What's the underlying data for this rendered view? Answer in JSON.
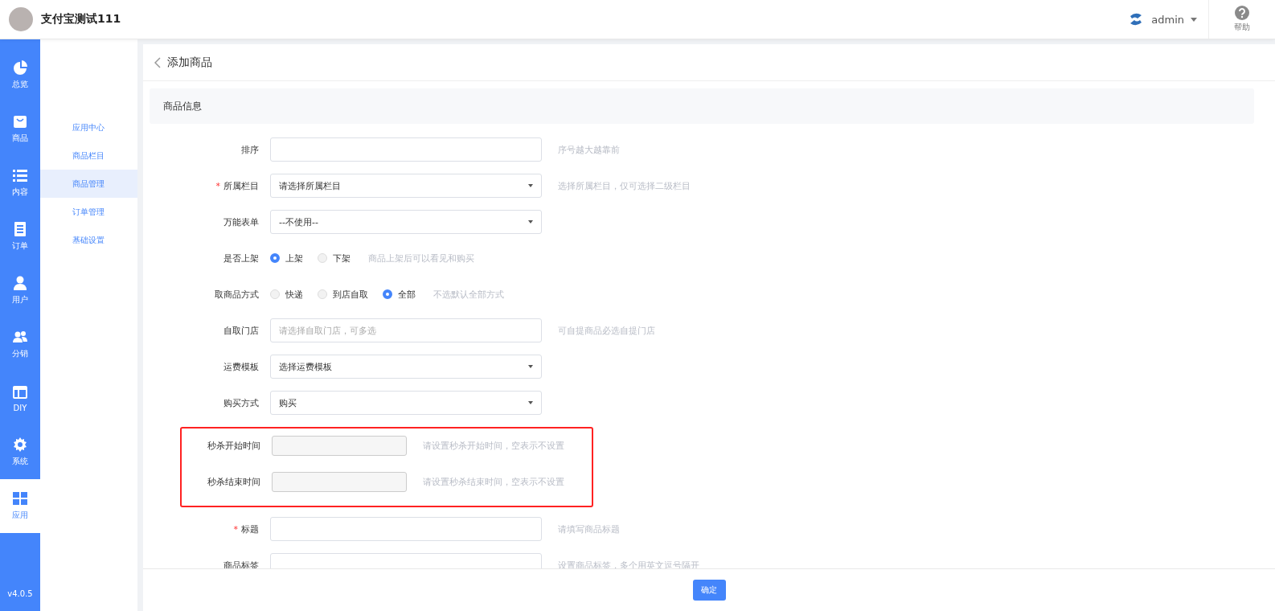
{
  "header": {
    "shop_name": "支付宝测试111",
    "user": "admin",
    "help": "帮助"
  },
  "main_nav": {
    "items": [
      {
        "label": "总览",
        "selected": false
      },
      {
        "label": "商品",
        "selected": false
      },
      {
        "label": "内容",
        "selected": false
      },
      {
        "label": "订单",
        "selected": false
      },
      {
        "label": "用户",
        "selected": false
      },
      {
        "label": "分销",
        "selected": false
      },
      {
        "label": "DIY",
        "selected": false
      },
      {
        "label": "系统",
        "selected": false
      },
      {
        "label": "应用",
        "selected": true
      }
    ],
    "version": "v4.0.5"
  },
  "sub_nav": {
    "items": [
      {
        "label": "应用中心",
        "selected": false
      },
      {
        "label": "商品栏目",
        "selected": false
      },
      {
        "label": "商品管理",
        "selected": true
      },
      {
        "label": "订单管理",
        "selected": false
      },
      {
        "label": "基础设置",
        "selected": false
      }
    ]
  },
  "page": {
    "title": "添加商品",
    "section": "商品信息",
    "rows": [
      {
        "kind": "input",
        "label": "排序",
        "highlighted": false,
        "hint": "序号越大越靠前"
      },
      {
        "kind": "select",
        "label": "所属栏目",
        "marker": "*",
        "highlighted": false,
        "value": "请选择所属栏目",
        "hint": "选择所属栏目，仅可选择二级栏目"
      },
      {
        "kind": "select",
        "label": "万能表单",
        "highlighted": false,
        "value": "--不使用--"
      },
      {
        "kind": "radio",
        "label": "是否上架",
        "highlighted": false,
        "options": [
          {
            "label": "上架",
            "selected": true
          },
          {
            "label": "下架",
            "selected": false
          }
        ],
        "hint": "商品上架后可以看见和购买"
      },
      {
        "kind": "radio",
        "label": "取商品方式",
        "highlighted": false,
        "options": [
          {
            "label": "快递",
            "selected": false
          },
          {
            "label": "到店自取",
            "selected": false
          },
          {
            "label": "全部",
            "selected": true
          }
        ],
        "hint": "不选默认全部方式"
      },
      {
        "kind": "input",
        "label": "自取门店",
        "highlighted": false,
        "placeholder": "请选择自取门店，可多选",
        "hint": "可自提商品必选自提门店"
      },
      {
        "kind": "select",
        "label": "运费模板",
        "highlighted": false,
        "value": "选择运费模板"
      },
      {
        "kind": "select",
        "label": "购买方式",
        "highlighted": false,
        "value": "购买"
      },
      {
        "kind": "time",
        "label": "秒杀开始时间",
        "highlighted": true,
        "hint": "请设置秒杀开始时间，空表示不设置"
      },
      {
        "kind": "time",
        "label": "秒杀结束时间",
        "highlighted": true,
        "hint": "请设置秒杀结束时间，空表示不设置"
      },
      {
        "kind": "input",
        "label": "标题",
        "marker": "*",
        "highlighted": false,
        "hint": "请填写商品标题"
      },
      {
        "kind": "input",
        "label": "商品标签",
        "highlighted": false,
        "hint": "设置商品标签，多个用英文逗号隔开"
      }
    ],
    "submit": "确定"
  }
}
